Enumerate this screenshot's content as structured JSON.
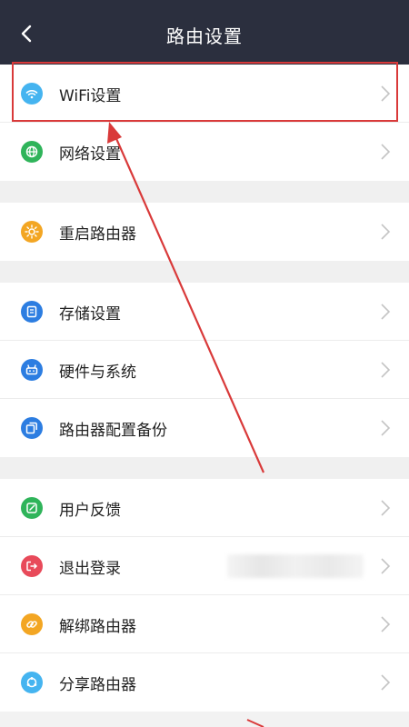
{
  "header": {
    "title": "路由设置"
  },
  "groups": [
    [
      {
        "label": "WiFi设置",
        "icon": "wifi-icon",
        "color": "#45b4f0"
      },
      {
        "label": "网络设置",
        "icon": "globe-icon",
        "color": "#2fb45a"
      }
    ],
    [
      {
        "label": "重启路由器",
        "icon": "restart-sun-icon",
        "color": "#f3a623"
      }
    ],
    [
      {
        "label": "存储设置",
        "icon": "storage-icon",
        "color": "#2c7de1"
      },
      {
        "label": "硬件与系统",
        "icon": "hardware-icon",
        "color": "#2c7de1"
      },
      {
        "label": "路由器配置备份",
        "icon": "backup-icon",
        "color": "#2c7de1"
      }
    ],
    [
      {
        "label": "用户反馈",
        "icon": "feedback-icon",
        "color": "#2fb45a"
      },
      {
        "label": "退出登录",
        "icon": "logout-icon",
        "color": "#e84a5a"
      },
      {
        "label": "解绑路由器",
        "icon": "link-icon",
        "color": "#f3a623"
      },
      {
        "label": "分享路由器",
        "icon": "share-icon",
        "color": "#45b4f0"
      }
    ]
  ],
  "annotation": {
    "highlight_color": "#d93a3a"
  }
}
